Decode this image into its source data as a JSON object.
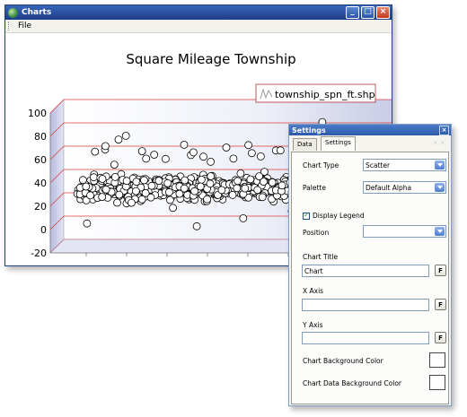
{
  "window": {
    "title": "Charts",
    "menu": [
      "File"
    ]
  },
  "chart_data": {
    "type": "scatter",
    "title": "Square Mileage Township",
    "legend": {
      "entries": [
        "township_spn_ft.shp"
      ],
      "placement": "top-right"
    },
    "ylim": [
      -20,
      100
    ],
    "yticks": [
      "100",
      "80",
      "60",
      "40",
      "20",
      "0",
      "-20"
    ],
    "grid": true,
    "three_d": true,
    "series": [
      {
        "name": "township_spn_ft.shp",
        "cluster": {
          "center": 30,
          "spread": 10,
          "count": 760
        },
        "outliers": [
          [
            0.02,
            0
          ],
          [
            0.06,
            65
          ],
          [
            0.08,
            63
          ],
          [
            0.1,
            71
          ],
          [
            0.12,
            70
          ],
          [
            0.13,
            55
          ],
          [
            0.17,
            80
          ],
          [
            0.2,
            60
          ],
          [
            0.23,
            58
          ],
          [
            0.26,
            62
          ],
          [
            0.29,
            56
          ],
          [
            0.33,
            62
          ],
          [
            0.36,
            55
          ],
          [
            0.39,
            63
          ],
          [
            0.43,
            61
          ],
          [
            0.46,
            58
          ],
          [
            0.49,
            64
          ],
          [
            0.52,
            56
          ],
          [
            0.55,
            62
          ],
          [
            0.58,
            60
          ],
          [
            0.61,
            57
          ],
          [
            0.65,
            59
          ],
          [
            0.68,
            63
          ],
          [
            0.71,
            60
          ],
          [
            0.74,
            55
          ],
          [
            0.78,
            57
          ],
          [
            0.81,
            84
          ],
          [
            0.84,
            60
          ],
          [
            0.41,
            2
          ],
          [
            0.55,
            4
          ],
          [
            0.3,
            10
          ],
          [
            0.7,
            6
          ],
          [
            0.15,
            12
          ],
          [
            0.9,
            8
          ]
        ]
      }
    ]
  },
  "settings": {
    "title": "Settings",
    "tabs": [
      "Data",
      "Settings"
    ],
    "active_tab": "Settings",
    "chart_type_label": "Chart Type",
    "chart_type_value": "Scatter",
    "palette_label": "Palette",
    "palette_value": "Default Alpha",
    "display_legend_label": "Display Legend",
    "display_legend_checked": true,
    "position_label": "Position",
    "position_value": "",
    "chart_title_label": "Chart Title",
    "chart_title_value": "Chart",
    "x_axis_label": "X Axis",
    "x_axis_value": "",
    "y_axis_label": "Y Axis",
    "y_axis_value": "",
    "f_button": "F",
    "bg_color_label": "Chart Background Color",
    "data_bg_color_label": "Chart Data Background Color",
    "bg_color": "#ffffff",
    "data_bg_color": "#ffffff"
  },
  "colors": {
    "grid": "#d84040",
    "wall": "#c9cce6",
    "marker_fill": "#ffffff",
    "marker_stroke": "#000000"
  }
}
